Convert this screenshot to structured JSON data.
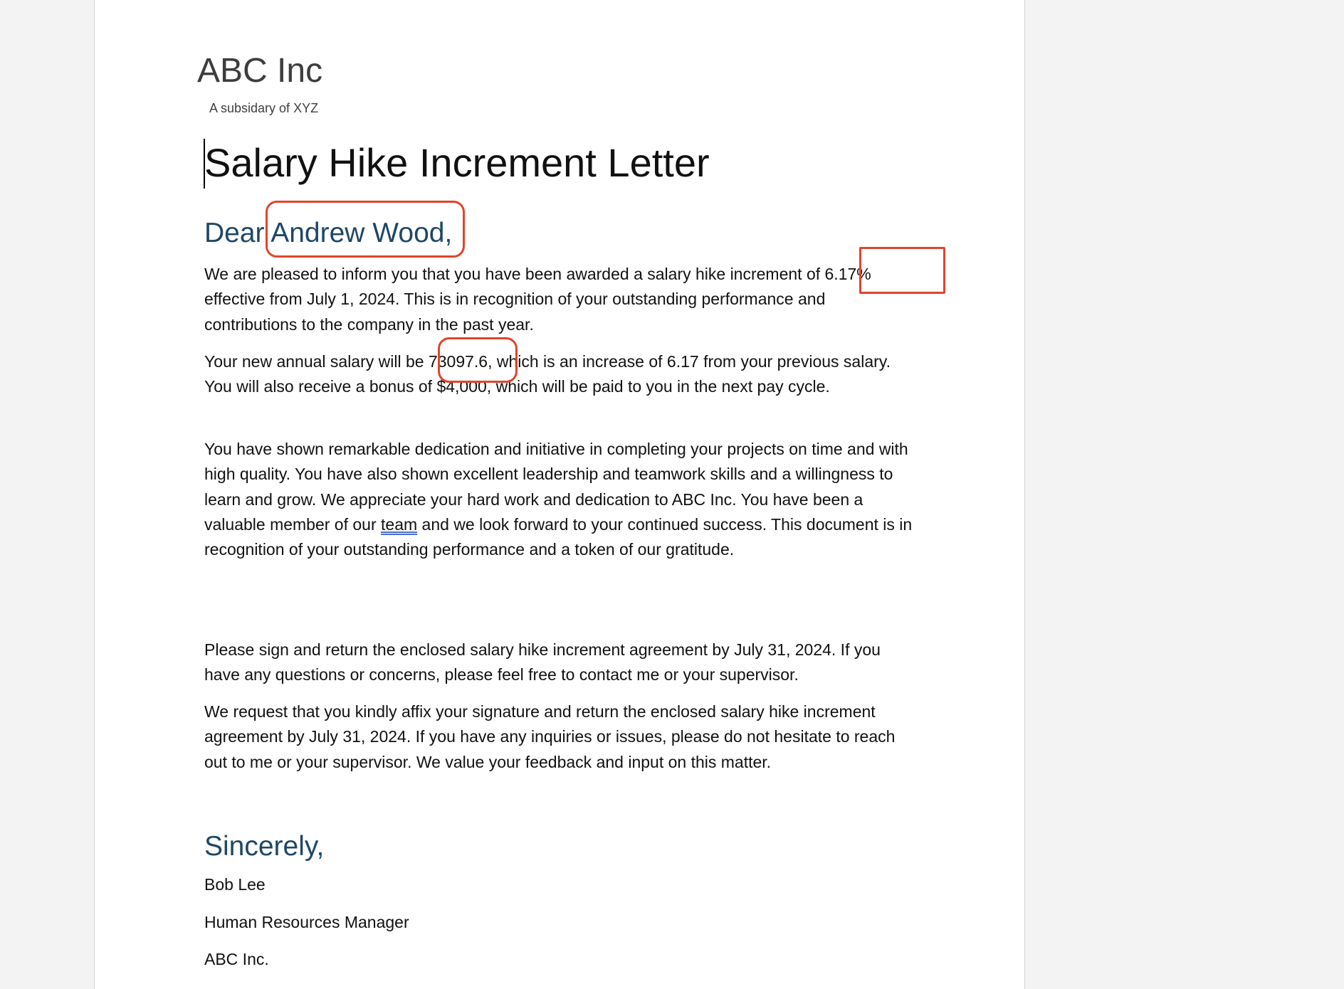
{
  "letterhead": {
    "company": "ABC Inc",
    "tagline": "A subsidary of XYZ"
  },
  "title": "Salary Hike Increment Letter",
  "salutation": "Dear Andrew Wood,",
  "paragraphs": {
    "p1": "We are pleased to inform you that you have been awarded a salary hike increment of 6.17% effective from July 1, 2024. This is in recognition of your outstanding performance and contributions to the company in the past year.",
    "p2": "Your new annual salary will be 73097.6, which is an increase of 6.17 from your previous salary. You will also receive a bonus of $4,000, which will be paid to you in the next pay cycle.",
    "p3_before": "You have shown remarkable dedication and initiative in completing your projects on time and with high quality. You have also shown excellent leadership and teamwork skills and a willingness to learn and grow. We appreciate your hard work and dedication to ABC Inc. You have been a valuable member of our ",
    "p3_link": "team",
    "p3_after": " and we look forward to your continued success. This document is in recognition of your outstanding performance and a token of our gratitude.",
    "p4": "Please sign and return the enclosed salary hike increment agreement by July 31, 2024. If you have any questions or concerns, please feel free to contact me or your supervisor.",
    "p5": "We request that you kindly affix your signature and return the enclosed salary hike increment agreement by July 31, 2024. If you have any inquiries or issues, please do not hesitate to reach out to me or your supervisor. We value your feedback and input on this matter."
  },
  "closing": "Sincerely,",
  "signature": {
    "name": "Bob Lee",
    "title": "Human Resources Manager",
    "company": "ABC Inc."
  },
  "colors": {
    "heading": "#1f4766",
    "annotation": "#e0452b"
  }
}
